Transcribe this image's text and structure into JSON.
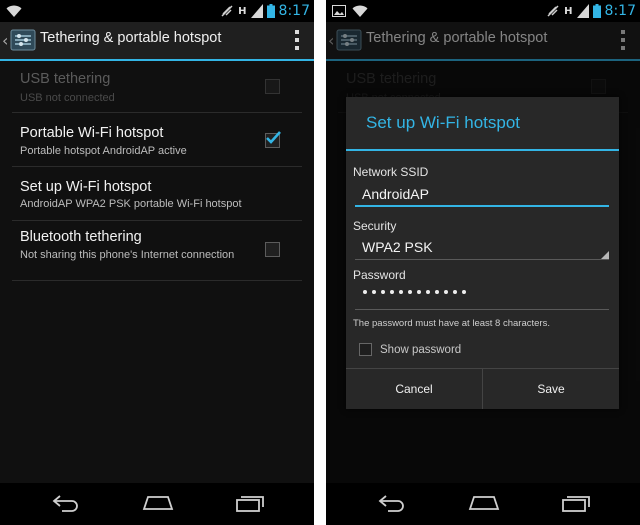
{
  "status_bar": {
    "time": "8:17",
    "network_type": "H",
    "icons": [
      "wifi-icon",
      "image-icon",
      "muted-icon",
      "signal-icon",
      "battery-icon"
    ]
  },
  "action_bar": {
    "title": "Tethering & portable hotspot",
    "app_icon": "tethering-settings-icon",
    "overflow_icon": "overflow-menu-icon"
  },
  "settings": {
    "items": [
      {
        "title": "USB tethering",
        "summary": "USB not connected",
        "checked": false,
        "enabled": false
      },
      {
        "title": "Portable Wi-Fi hotspot",
        "summary": "Portable hotspot AndroidAP active",
        "checked": true,
        "enabled": true
      },
      {
        "title": "Set up Wi-Fi hotspot",
        "summary": "AndroidAP WPA2 PSK portable Wi-Fi hotspot",
        "enabled": true
      },
      {
        "title": "Bluetooth tethering",
        "summary": "Not sharing this phone's Internet connection",
        "checked": false,
        "enabled": true
      }
    ]
  },
  "dialog": {
    "title": "Set up Wi-Fi hotspot",
    "ssid_label": "Network SSID",
    "ssid_value": "AndroidAP",
    "security_label": "Security",
    "security_value": "WPA2 PSK",
    "password_label": "Password",
    "password_length": 12,
    "password_hint": "The password must have at least 8 characters.",
    "show_password_label": "Show password",
    "show_password_checked": false,
    "cancel_label": "Cancel",
    "save_label": "Save"
  },
  "nav_bar": {
    "icons": [
      "back-icon",
      "home-icon",
      "recent-apps-icon"
    ]
  },
  "colors": {
    "accent": "#33b5e5",
    "background": "#101010",
    "action_bar": "#1f1f1f",
    "dialog": "#282828"
  }
}
